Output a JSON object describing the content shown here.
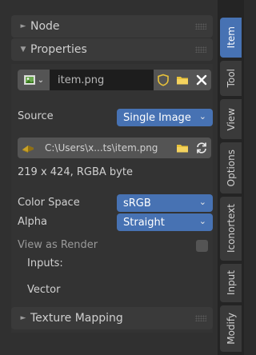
{
  "sections": {
    "node": {
      "arrow": "►",
      "title": "Node"
    },
    "properties": {
      "arrow": "▼",
      "title": "Properties"
    },
    "texture_mapping": {
      "arrow": "►",
      "title": "Texture Mapping"
    }
  },
  "image": {
    "name": "item.png",
    "icon": "image-icon",
    "fake_user_icon": "shield-icon",
    "open_icon": "folder-icon",
    "close_icon": "close-icon"
  },
  "source": {
    "label": "Source",
    "value": "Single Image"
  },
  "filepath": {
    "value": "C:\\Users\\x...ts\\item.png",
    "icon": "file-packed-icon",
    "reload_icon": "reload-icon"
  },
  "image_info": "219 x 424,  RGBA byte",
  "color_space": {
    "label": "Color Space",
    "value": "sRGB"
  },
  "alpha": {
    "label": "Alpha",
    "value": "Straight"
  },
  "view_as_render": {
    "label": "View as Render",
    "checked": false
  },
  "inputs_label": "Inputs:",
  "vector_label": "Vector",
  "tabs": [
    {
      "label": "Item",
      "active": true
    },
    {
      "label": "Tool",
      "active": false
    },
    {
      "label": "View",
      "active": false
    },
    {
      "label": "Options",
      "active": false
    },
    {
      "label": "Iconortext",
      "active": false
    },
    {
      "label": "Input",
      "active": false
    },
    {
      "label": "Modify",
      "active": false
    }
  ],
  "colors": {
    "accent": "#4772b3",
    "folder": "#e8c23a",
    "panel": "#303030"
  }
}
